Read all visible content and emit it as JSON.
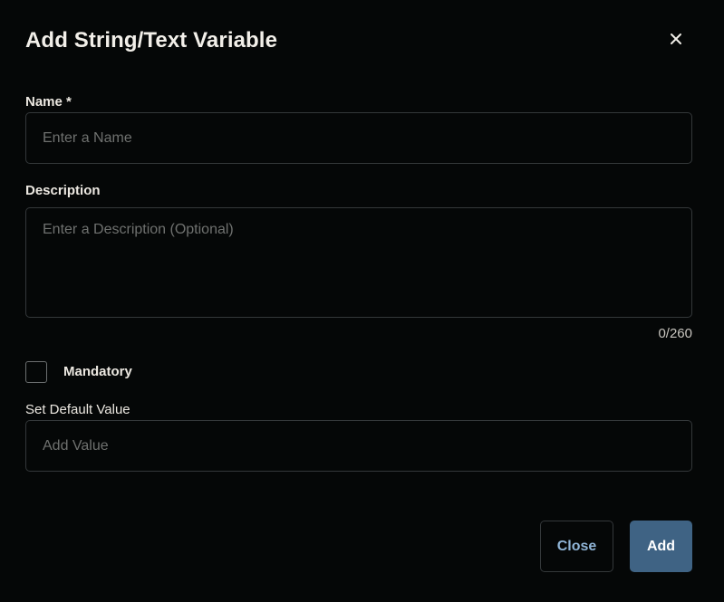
{
  "dialog": {
    "title": "Add String/Text Variable",
    "close_icon": "close-icon"
  },
  "form": {
    "name": {
      "label": "Name *",
      "placeholder": "Enter a Name",
      "value": ""
    },
    "description": {
      "label": "Description",
      "placeholder": "Enter a Description (Optional)",
      "value": "",
      "counter": "0/260"
    },
    "mandatory": {
      "label": "Mandatory",
      "checked": false
    },
    "default_value": {
      "label": "Set Default Value",
      "placeholder": "Add Value",
      "value": ""
    }
  },
  "footer": {
    "close_label": "Close",
    "add_label": "Add"
  },
  "colors": {
    "background": "#050707",
    "border": "#34383a",
    "primary": "#3f6384",
    "link": "#8fb4d6"
  }
}
